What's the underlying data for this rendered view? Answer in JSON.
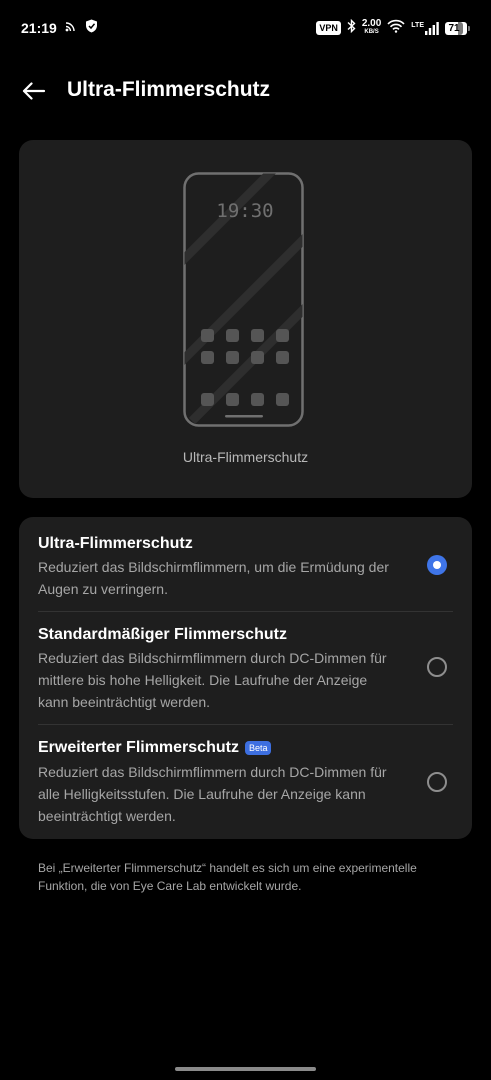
{
  "status_bar": {
    "time": "21:19",
    "vpn": "VPN",
    "speed_value": "2.00",
    "speed_unit": "KB/S",
    "network_type": "LTE",
    "battery": "71"
  },
  "header": {
    "back_icon": "arrow-left-icon",
    "title": "Ultra-Flimmerschutz"
  },
  "preview": {
    "clock": "19:30",
    "label": "Ultra-Flimmerschutz"
  },
  "options": [
    {
      "title": "Ultra-Flimmerschutz",
      "description": "Reduziert das Bildschirmflimmern, um die Ermüdung der Augen zu verringern.",
      "selected": true
    },
    {
      "title": "Standardmäßiger Flimmerschutz",
      "description": "Reduziert das Bildschirmflimmern durch DC-Dimmen für mittlere bis hohe Helligkeit. Die Laufruhe der Anzeige kann beeinträchtigt werden.",
      "selected": false
    },
    {
      "title": "Erweiterter Flimmerschutz",
      "badge": "Beta",
      "description": "Reduziert das Bildschirmflimmern durch DC-Dimmen für alle Helligkeitsstufen. Die Laufruhe der Anzeige kann beeinträchtigt werden.",
      "selected": false
    }
  ],
  "footnote": "Bei „Erweiterter Flimmerschutz“ handelt es sich um eine experimentelle Funktion, die von Eye Care Lab entwickelt wurde.",
  "colors": {
    "background": "#000000",
    "card": "#1e1e1e",
    "accent": "#3f75e8"
  }
}
